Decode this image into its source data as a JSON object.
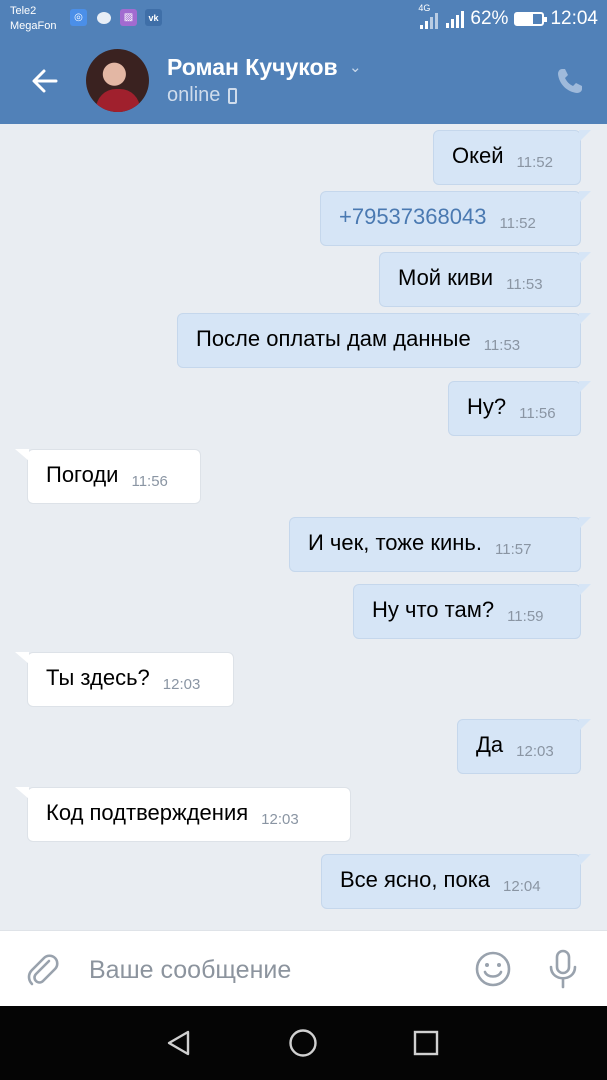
{
  "status": {
    "carrier1": "Tele2",
    "carrier2": "MegaFon",
    "network": "4G",
    "battery_percent": "62%",
    "battery_level": 0.62,
    "time": "12:04"
  },
  "header": {
    "contact_name": "Роман Кучуков",
    "status": "online"
  },
  "messages": [
    {
      "dir": "out",
      "text": "Окей",
      "time": "11:52"
    },
    {
      "dir": "out",
      "text": "+79537368043",
      "time": "11:52",
      "link": true
    },
    {
      "dir": "out",
      "text": "Мой киви",
      "time": "11:53"
    },
    {
      "dir": "out",
      "text": "После оплаты дам данные",
      "time": "11:53"
    },
    {
      "dir": "out",
      "text": "Ну?",
      "time": "11:56"
    },
    {
      "dir": "in",
      "text": "Погоди",
      "time": "11:56"
    },
    {
      "dir": "out",
      "text": "И чек, тоже кинь.",
      "time": "11:57"
    },
    {
      "dir": "out",
      "text": "Ну что там?",
      "time": "11:59"
    },
    {
      "dir": "in",
      "text": "Ты здесь?",
      "time": "12:03"
    },
    {
      "dir": "out",
      "text": "Да",
      "time": "12:03"
    },
    {
      "dir": "in",
      "text": "Код подтверждения",
      "time": "12:03"
    },
    {
      "dir": "out",
      "text": "Все ясно, пока",
      "time": "12:04"
    }
  ],
  "input": {
    "placeholder": "Ваше сообщение"
  },
  "colors": {
    "header_bg": "#5181b8",
    "outgoing_bubble": "#d6e5f6",
    "incoming_bubble": "#ffffff",
    "chat_bg": "#e9edf2"
  }
}
